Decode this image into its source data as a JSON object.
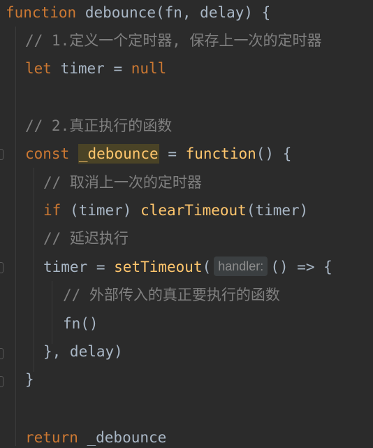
{
  "lines": {
    "l1": {
      "kw": "function",
      "name": "debounce",
      "params": "(fn, delay) {"
    },
    "l2": {
      "comment": "// 1.定义一个定时器, 保存上一次的定时器"
    },
    "l3": {
      "kw": "let",
      "rest": " timer = ",
      "val": "null"
    },
    "l5": {
      "comment": "// 2.真正执行的函数"
    },
    "l6": {
      "kw": "const",
      "var": "_debounce",
      "eq": " = ",
      "fnkw": "function",
      "rest": "() {"
    },
    "l7": {
      "comment": "// 取消上一次的定时器"
    },
    "l8": {
      "kw": "if",
      "cond": " (timer) ",
      "call": "clearTimeout",
      "args": "(timer)"
    },
    "l9": {
      "comment": "// 延迟执行"
    },
    "l10": {
      "pre": "timer = ",
      "call": "setTimeout",
      "open": "(",
      "hint": "handler:",
      "rest": "() => {"
    },
    "l11": {
      "comment": "// 外部传入的真正要执行的函数"
    },
    "l12": {
      "text": "fn()"
    },
    "l13": {
      "text": "}, delay)"
    },
    "l14": {
      "text": "}"
    },
    "l16": {
      "kw": "return",
      "rest": " _debounce"
    }
  },
  "colors": {
    "background": "#2b2b2b",
    "keyword": "#cc7832",
    "function_name": "#ffc66d",
    "comment": "#808080",
    "plain": "#a9b7c6",
    "highlight": "#4a4326"
  }
}
